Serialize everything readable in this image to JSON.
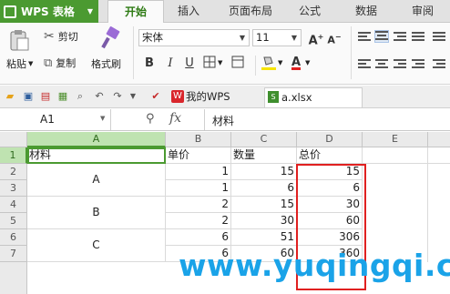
{
  "app": {
    "title": "WPS 表格"
  },
  "ribbon_tabs": [
    "开始",
    "插入",
    "页面布局",
    "公式",
    "数据",
    "审阅"
  ],
  "active_tab": "开始",
  "clipboard": {
    "paste": "粘贴",
    "cut": "剪切",
    "copy": "复制",
    "format_painter": "格式刷"
  },
  "font": {
    "name": "宋体",
    "size": "11",
    "bold": "B",
    "italic": "I",
    "underline": "U"
  },
  "doc_tabs": [
    {
      "label": "我的WPS"
    },
    {
      "label": "a.xlsx"
    }
  ],
  "formula_bar": {
    "cell_ref": "A1",
    "fx": "fx",
    "content": "材料"
  },
  "columns": [
    "A",
    "B",
    "C",
    "D",
    "E"
  ],
  "rows": [
    "1",
    "2",
    "3",
    "4",
    "5",
    "6",
    "7"
  ],
  "sheet": {
    "header": [
      "材料",
      "单价",
      "数量",
      "总价"
    ],
    "groups": [
      {
        "label": "A",
        "rows": [
          {
            "unit_price": "1",
            "qty": "15",
            "total": "15"
          },
          {
            "unit_price": "1",
            "qty": "6",
            "total": "6"
          }
        ]
      },
      {
        "label": "B",
        "rows": [
          {
            "unit_price": "2",
            "qty": "15",
            "total": "30"
          },
          {
            "unit_price": "2",
            "qty": "30",
            "total": "60"
          }
        ]
      },
      {
        "label": "C",
        "rows": [
          {
            "unit_price": "6",
            "qty": "51",
            "total": "306"
          },
          {
            "unit_price": "6",
            "qty": "60",
            "total": "360"
          }
        ]
      }
    ]
  },
  "watermark": "www.yuqingqi.com",
  "colors": {
    "accent": "#4b9a31",
    "highlight_border": "#e02020",
    "watermark": "#1aa3e8"
  }
}
